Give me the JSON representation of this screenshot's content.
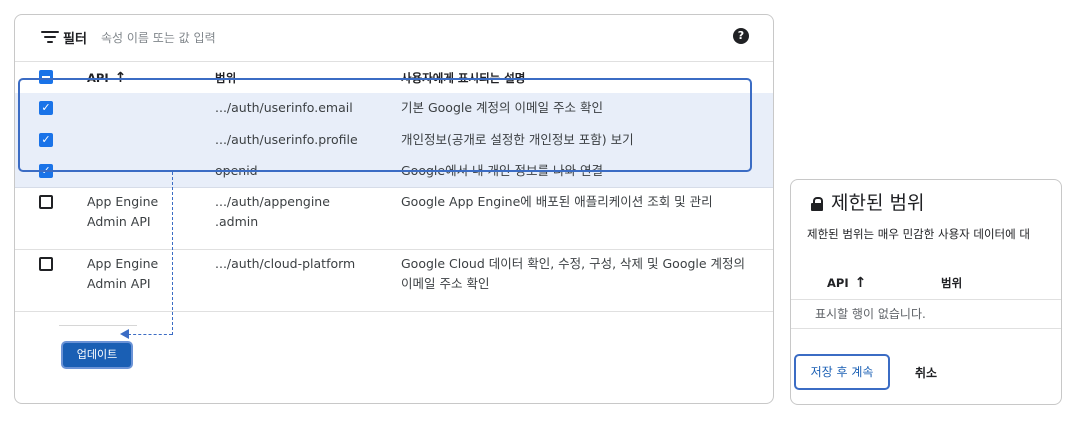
{
  "filter": {
    "label": "필터",
    "placeholder": "속성 이름 또는 값 입력",
    "help_icon": "?"
  },
  "table": {
    "headers": {
      "api": "API",
      "sort_icon": "↑",
      "scope": "범위",
      "description": "사용자에게 표시되는 설명"
    },
    "rows": [
      {
        "checked": true,
        "api": "",
        "api2": "",
        "scope": ".../auth/userinfo.email",
        "scope2": "",
        "desc": "기본 Google 계정의 이메일 주소 확인",
        "desc2": ""
      },
      {
        "checked": true,
        "api": "",
        "api2": "",
        "scope": ".../auth/userinfo.profile",
        "scope2": "",
        "desc": "개인정보(공개로 설정한 개인정보 포함) 보기",
        "desc2": ""
      },
      {
        "checked": true,
        "api": "",
        "api2": "",
        "scope": "openid",
        "scope2": "",
        "desc": "Google에서 내 개인 정보를 나와 연결",
        "desc2": ""
      },
      {
        "checked": false,
        "api": "App Engine",
        "api2": "Admin API",
        "scope": ".../auth/appengine",
        "scope2": ".admin",
        "desc": "Google App Engine에 배포된 애플리케이션 조회 및 관리",
        "desc2": ""
      },
      {
        "checked": false,
        "api": "App Engine",
        "api2": "Admin API",
        "scope": ".../auth/cloud-platform",
        "scope2": "",
        "desc": "Google Cloud 데이터 확인, 수정, 구성, 삭제 및 Google 계정의",
        "desc2": "이메일 주소 확인"
      }
    ]
  },
  "update_button": "업데이트",
  "dialog": {
    "title": "제한된 범위",
    "description": "제한된 범위는 매우 민감한 사용자 데이터에 대",
    "headers": {
      "api": "API",
      "sort_icon": "↑",
      "scope": "범위"
    },
    "empty_text": "표시할 행이 없습니다.",
    "save_button": "저장 후 계속",
    "cancel_button": "취소"
  },
  "colors": {
    "accent": "#1a73e8",
    "selected_row": "#e8eef9",
    "highlight_outline": "#3b6cc4"
  }
}
